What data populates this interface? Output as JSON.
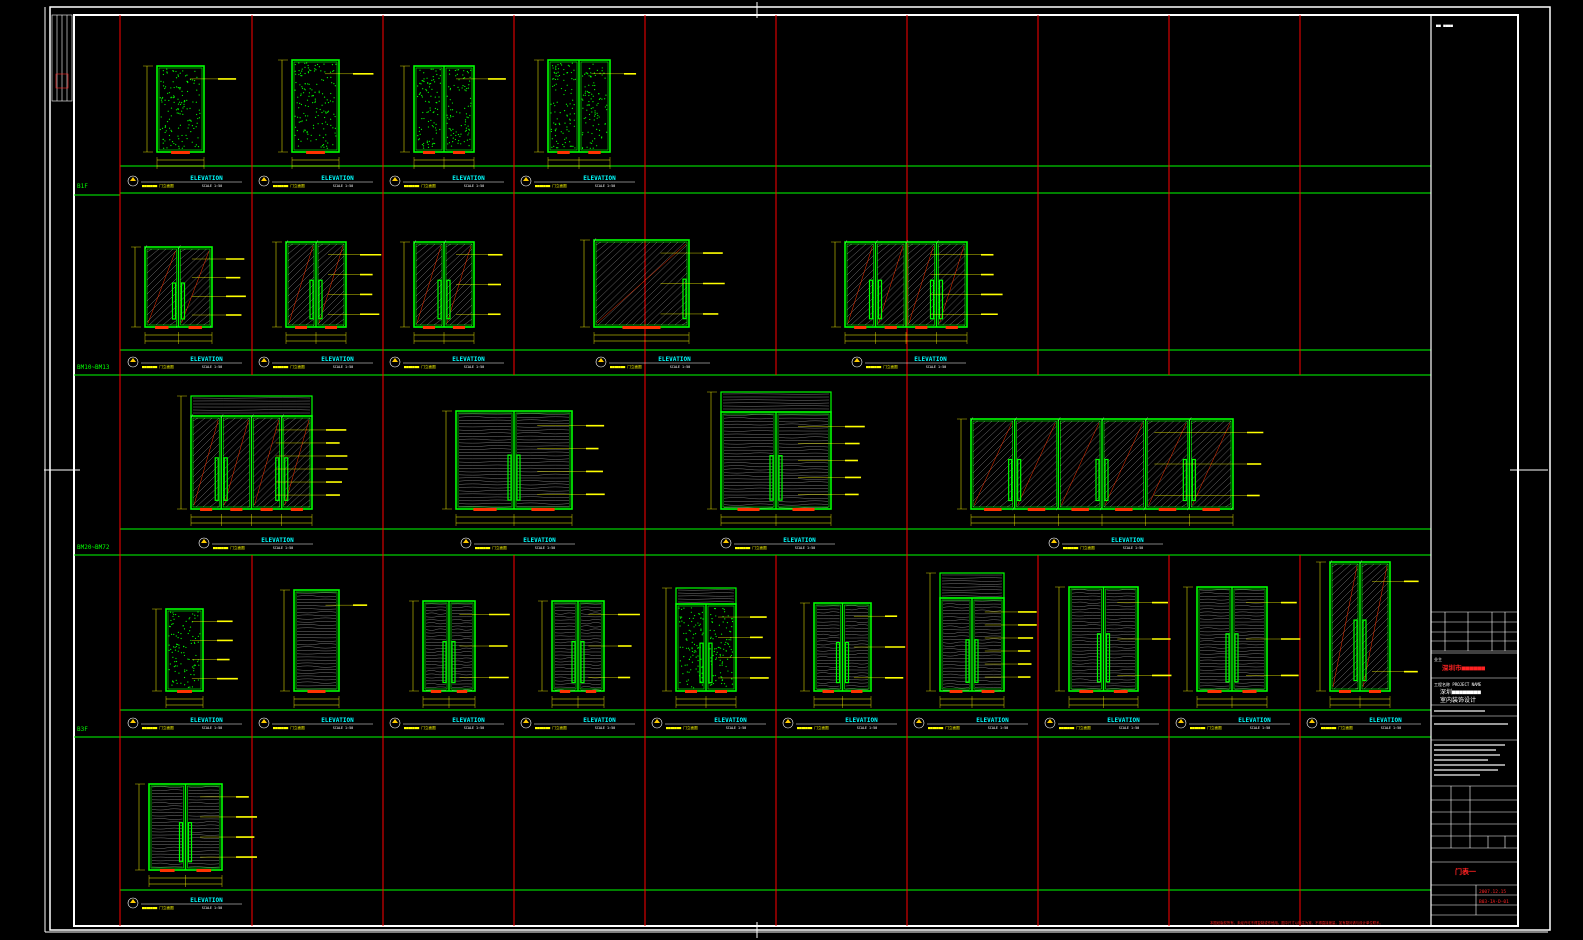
{
  "sheet": {
    "row_labels": [
      "B1F",
      "BM10~BM13",
      "BM20~BM72",
      "B3F"
    ],
    "elevation_word": "ELEVATION",
    "scale_text": "SCALE 1:50",
    "title_bar_text": "■■■■■■■ 门立面图"
  },
  "title_block": {
    "top_note": "■■  ■■■■",
    "client_label": "业主",
    "client_name": "深圳市■■■■■■",
    "project_label": "工程名称 PROJECT NAME",
    "project_name_1": "深圳■■■■■■■■",
    "project_name_2": "室内装饰设计",
    "drawing_title": "门表一",
    "date_value": "2007.12.15",
    "number_value": "B03-IA-D-01",
    "bottom_note": "本图纸版权所有，未经许可不得复制或作他用。图中尺寸以标注为准，不得直接度量。如有疑问请与设计单位联系。"
  },
  "colors": {
    "background": "#000000",
    "frame": "#ffffff",
    "grid_red": "#ff0000",
    "grid_green": "#00ff00",
    "door_green": "#00ff00",
    "door_red": "#ff3300",
    "annotation_yellow": "#ffff00",
    "texture_white": "#cccccc",
    "elevation_cyan": "#00ffff",
    "tag_yellow": "#ffcc00",
    "title_red": "#ff2222"
  }
}
